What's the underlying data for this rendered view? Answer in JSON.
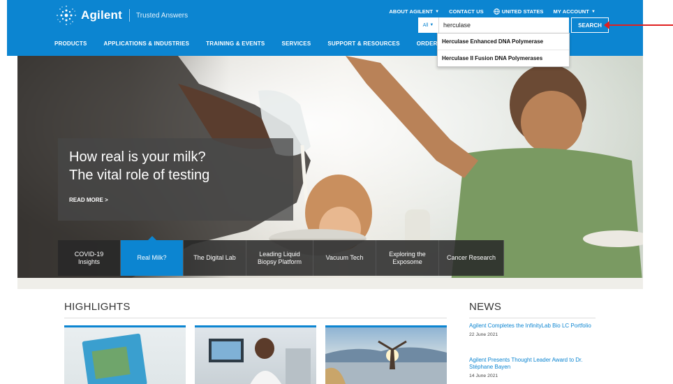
{
  "brand": {
    "name": "Agilent",
    "tagline": "Trusted Answers",
    "color": "#0c85d1"
  },
  "utility_nav": [
    {
      "label": "ABOUT AGILENT",
      "icon": "chevron-down-icon"
    },
    {
      "label": "CONTACT US",
      "icon": ""
    },
    {
      "label": "UNITED STATES",
      "icon": "globe-icon"
    },
    {
      "label": "MY ACCOUNT",
      "icon": "chevron-down-icon"
    }
  ],
  "search": {
    "scope": "All",
    "value": "herculase",
    "button_label": "SEARCH",
    "suggestions": [
      "Herculase Enhanced DNA Polymerase",
      "Herculase II Fusion DNA Polymerases"
    ]
  },
  "main_nav": [
    "PRODUCTS",
    "APPLICATIONS & INDUSTRIES",
    "TRAINING & EVENTS",
    "SERVICES",
    "SUPPORT & RESOURCES",
    "ORDER C"
  ],
  "hero": {
    "title_line1": "How real is your milk?",
    "title_line2": "The vital role of testing",
    "read_more": "READ MORE >",
    "tabs": [
      {
        "line1": "COVID-19",
        "line2": "Insights",
        "active": false
      },
      {
        "line1": "Real Milk?",
        "line2": "",
        "active": true
      },
      {
        "line1": "The Digital Lab",
        "line2": "",
        "active": false
      },
      {
        "line1": "Leading Liquid",
        "line2": "Biopsy Platform",
        "active": false
      },
      {
        "line1": "Vacuum Tech",
        "line2": "",
        "active": false
      },
      {
        "line1": "Exploring the",
        "line2": "Exposome",
        "active": false
      },
      {
        "line1": "Cancer Research",
        "line2": "",
        "active": false
      }
    ]
  },
  "highlights": {
    "title": "HIGHLIGHTS"
  },
  "news": {
    "title": "NEWS",
    "items": [
      {
        "headline": "Agilent Completes the InfinityLab Bio LC Portfolio",
        "date": "22 June 2021"
      },
      {
        "headline": "Agilent Presents Thought Leader Award to Dr. Stéphane Bayen",
        "date": "14 June 2021"
      }
    ]
  }
}
